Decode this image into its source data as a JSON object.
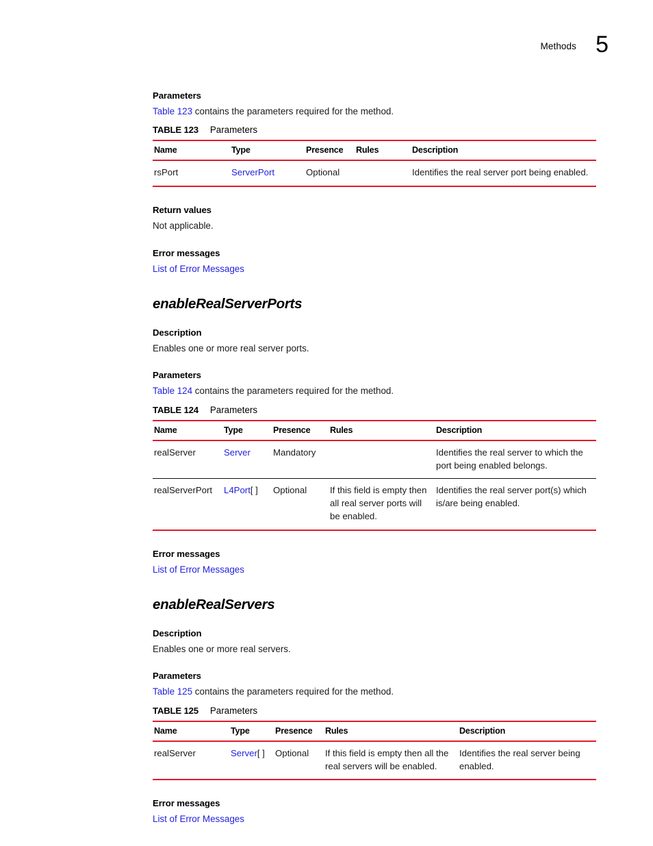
{
  "header": {
    "label": "Methods",
    "chapter": "5"
  },
  "sections": [
    {
      "parameters_head": "Parameters",
      "parameters_intro_link": "Table 123",
      "parameters_intro_rest": " contains the parameters required for the method.",
      "return_head": "Return values",
      "return_text": "Not applicable.",
      "error_head": "Error messages",
      "error_link": "List of Error Messages"
    }
  ],
  "table123": {
    "caption_num": "TABLE 123",
    "caption_title": "Parameters",
    "columns": [
      "Name",
      "Type",
      "Presence",
      "Rules",
      "Description"
    ],
    "col_widths": [
      "113px",
      "109px",
      "73px",
      "82px",
      "271px"
    ],
    "rows": [
      {
        "name": "rsPort",
        "type_link": "ServerPort",
        "type_suffix": "",
        "presence": "Optional",
        "rules": "",
        "description": "Identifies the real server port being enabled."
      }
    ]
  },
  "method1": {
    "title": "enableRealServerPorts",
    "description_head": "Description",
    "description_text": "Enables one or more real server ports.",
    "parameters_head": "Parameters",
    "parameters_intro_link": "Table 124",
    "parameters_intro_rest": " contains the parameters required for the method.",
    "error_head": "Error messages",
    "error_link": "List of Error Messages"
  },
  "table124": {
    "caption_num": "TABLE 124",
    "caption_title": "Parameters",
    "columns": [
      "Name",
      "Type",
      "Presence",
      "Rules",
      "Description"
    ],
    "col_widths": [
      "102px",
      "72px",
      "83px",
      "155px",
      "236px"
    ],
    "rows": [
      {
        "name": "realServer",
        "type_link": "Server",
        "type_suffix": "",
        "presence": "Mandatory",
        "rules": "",
        "description": "Identifies the real server to which the port being enabled belongs."
      },
      {
        "name": "realServerPort",
        "type_link": "L4Port",
        "type_suffix": "[ ]",
        "presence": "Optional",
        "rules": "If this field is empty then all real server ports will be enabled.",
        "description": "Identifies the real server port(s) which is/are being enabled."
      }
    ]
  },
  "method2": {
    "title": "enableRealServers",
    "description_head": "Description",
    "description_text": "Enables one or more real servers.",
    "parameters_head": "Parameters",
    "parameters_intro_link": "Table 125",
    "parameters_intro_rest": " contains the parameters required for the method.",
    "error_head": "Error messages",
    "error_link": "List of Error Messages"
  },
  "table125": {
    "caption_num": "TABLE 125",
    "caption_title": "Parameters",
    "columns": [
      "Name",
      "Type",
      "Presence",
      "Rules",
      "Description"
    ],
    "col_widths": [
      "112px",
      "65px",
      "73px",
      "196px",
      "202px"
    ],
    "rows": [
      {
        "name": "realServer",
        "type_link": "Server",
        "type_suffix": "[ ]",
        "presence": "Optional",
        "rules": "If this field is empty then all the real servers will be enabled.",
        "description": "Identifies the real server being enabled."
      }
    ]
  },
  "colors": {
    "rule_red": "#e01a2b",
    "link_blue": "#2222dd",
    "text_black": "#1a1a1a"
  }
}
